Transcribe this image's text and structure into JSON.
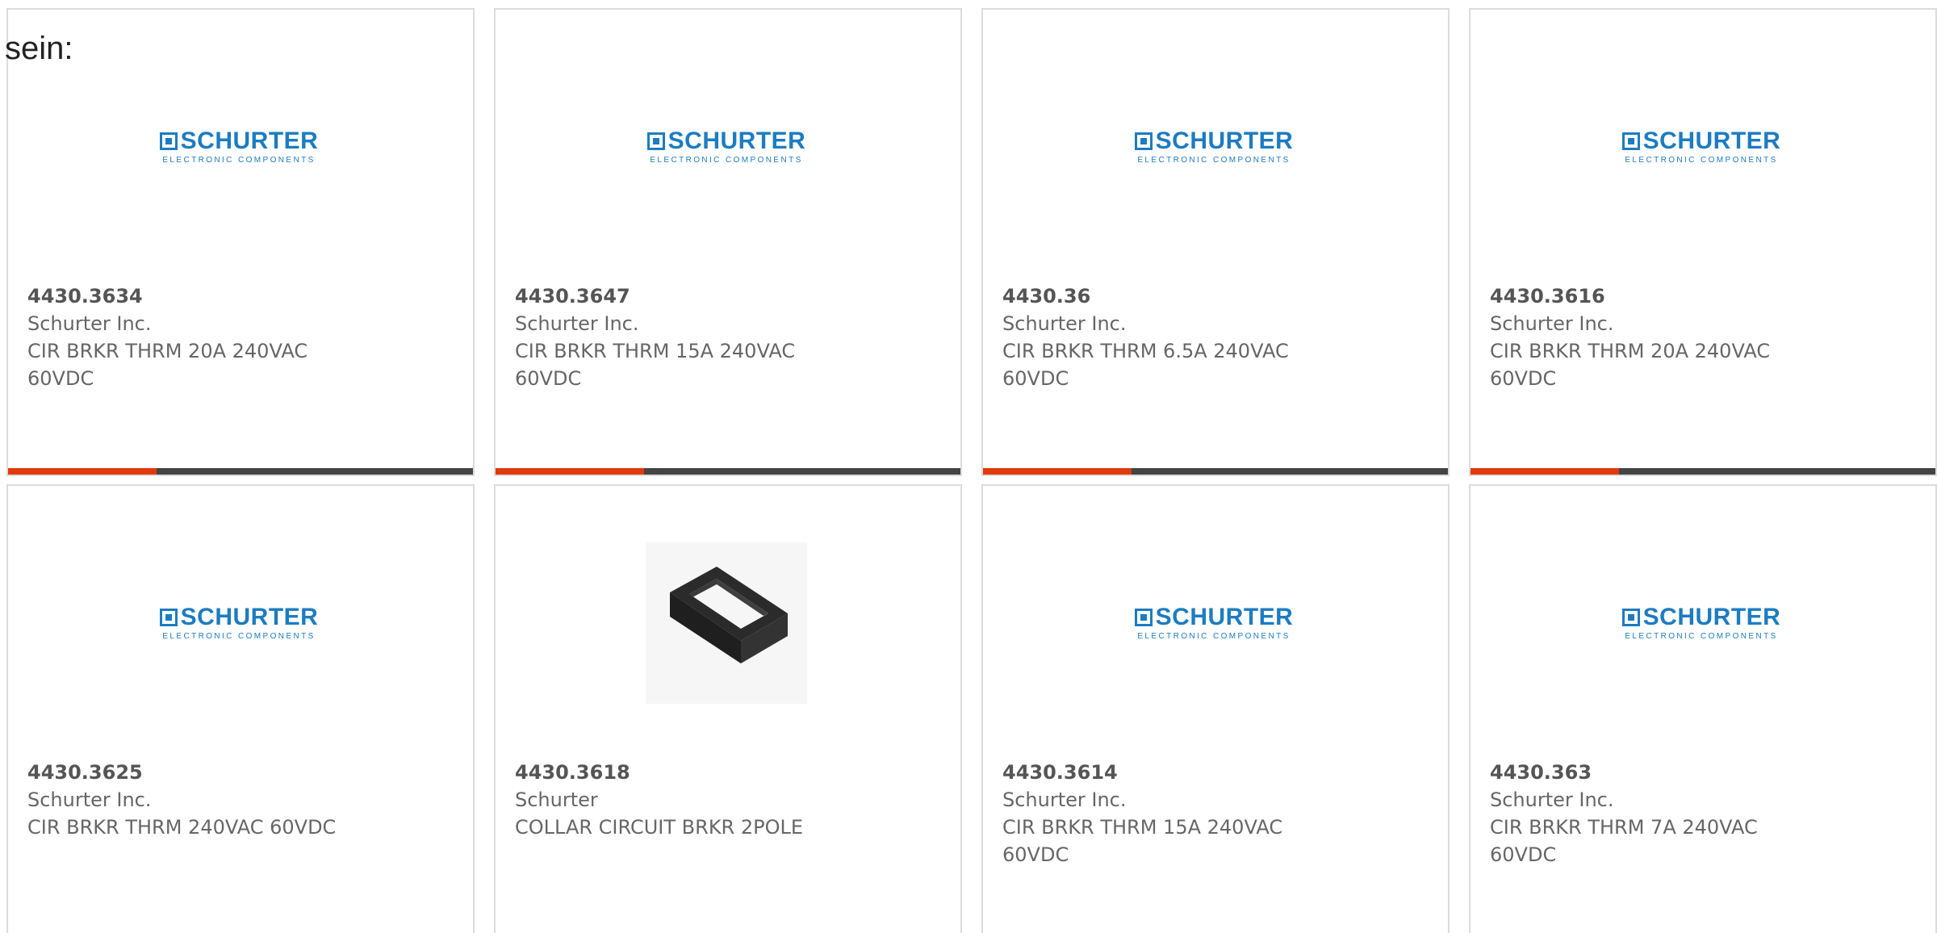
{
  "lead_text": "sein:",
  "colors": {
    "accent": "#e03a0d",
    "track": "#444444",
    "brand": "#1c7cc1",
    "border": "#dcdcdc"
  },
  "logo": {
    "word": "SCHURTER",
    "tagline": "ELECTRONIC COMPONENTS"
  },
  "products": [
    {
      "part": "4430.3634",
      "manufacturer": "Schurter Inc.",
      "description": "CIR BRKR THRM 20A 240VAC 60VDC",
      "image": "schurter-logo",
      "progress": 0.32
    },
    {
      "part": "4430.3647",
      "manufacturer": "Schurter Inc.",
      "description": "CIR BRKR THRM 15A 240VAC 60VDC",
      "image": "schurter-logo",
      "progress": 0.32
    },
    {
      "part": "4430.36",
      "manufacturer": "Schurter Inc.",
      "description": "CIR BRKR THRM 6.5A 240VAC 60VDC",
      "image": "schurter-logo",
      "progress": 0.32
    },
    {
      "part": "4430.3616",
      "manufacturer": "Schurter Inc.",
      "description": "CIR BRKR THRM 20A 240VAC 60VDC",
      "image": "schurter-logo",
      "progress": 0.32
    },
    {
      "part": "4430.3625",
      "manufacturer": "Schurter Inc.",
      "description": "CIR BRKR THRM 240VAC 60VDC",
      "image": "schurter-logo",
      "progress": null
    },
    {
      "part": "4430.3618",
      "manufacturer": "Schurter",
      "description": "COLLAR CIRCUIT BRKR 2POLE",
      "image": "collar-photo",
      "progress": null
    },
    {
      "part": "4430.3614",
      "manufacturer": "Schurter Inc.",
      "description": "CIR BRKR THRM 15A 240VAC 60VDC",
      "image": "schurter-logo",
      "progress": null
    },
    {
      "part": "4430.363",
      "manufacturer": "Schurter Inc.",
      "description": "CIR BRKR THRM 7A 240VAC 60VDC",
      "image": "schurter-logo",
      "progress": null
    }
  ]
}
